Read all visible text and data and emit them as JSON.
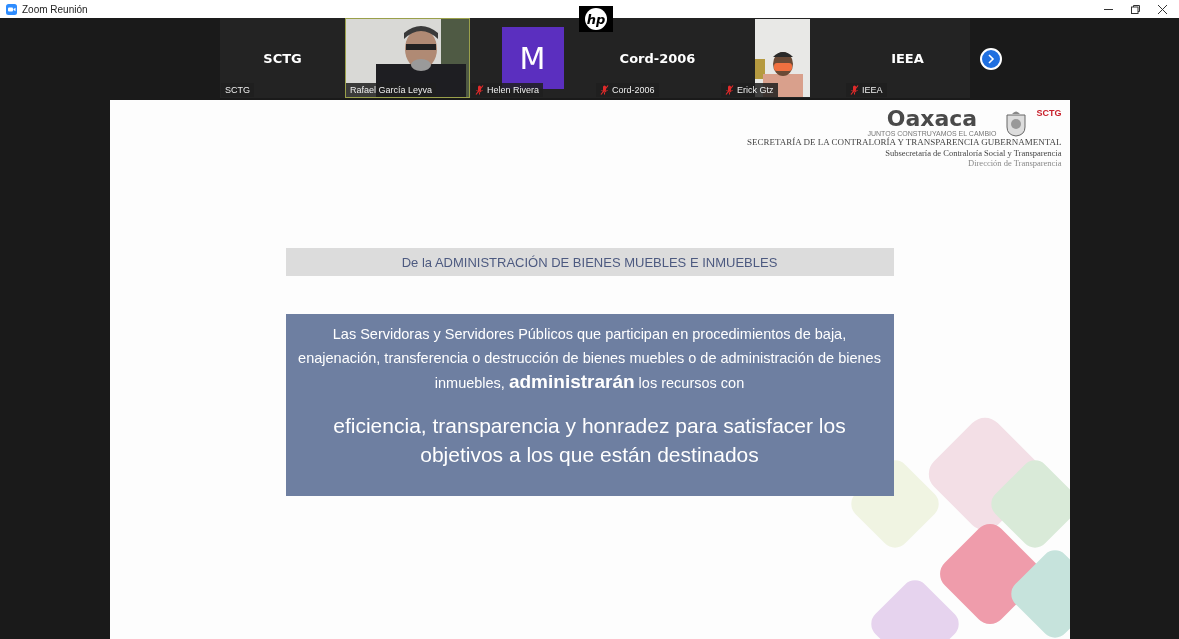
{
  "window": {
    "title": "Zoom Reunión"
  },
  "overlay_logo": {
    "text": "hp"
  },
  "participants": [
    {
      "kind": "name",
      "display": "SCTG",
      "label": "SCTG",
      "muted": false,
      "speaking": false
    },
    {
      "kind": "video",
      "label": "Rafael García Leyva",
      "muted": false,
      "speaking": true
    },
    {
      "kind": "avatar",
      "display": "M",
      "label": "Helen Rivera",
      "muted": true,
      "speaking": false
    },
    {
      "kind": "name",
      "display": "Cord-2006",
      "label": "Cord-2006",
      "muted": true,
      "speaking": false
    },
    {
      "kind": "video",
      "label": "Erick Gtz",
      "muted": true,
      "speaking": false
    },
    {
      "kind": "name",
      "display": "IEEA",
      "label": "IEEA",
      "muted": true,
      "speaking": false
    }
  ],
  "slide": {
    "logo": {
      "name": "Oaxaca",
      "tagline": "JUNTOS CONSTRUYAMOS EL CAMBIO",
      "badge": "SCTG"
    },
    "header_lines": [
      "SECRETARÍA DE LA CONTRALORÍA Y TRANSPARENCIA GUBERNAMENTAL",
      "Subsecretaría de Contraloría Social y Transparencia",
      "Dirección de Transparencia"
    ],
    "heading": "De la ADMINISTRACIÓN DE BIENES MUEBLES E INMUEBLES",
    "body_segments": [
      {
        "text": "Las Servidoras y Servidores Públicos que participan en procedimientos de baja, enajenación, transferencia o destrucción de bienes muebles o de administración de bienes inmuebles, ",
        "emphasis": false
      },
      {
        "text": "administrarán",
        "emphasis": true
      },
      {
        "text": " los recursos con",
        "emphasis": false
      }
    ],
    "conclusion": "eficiencia, transparencia y honradez para satisfacer los objetivos a los que están destinados"
  }
}
